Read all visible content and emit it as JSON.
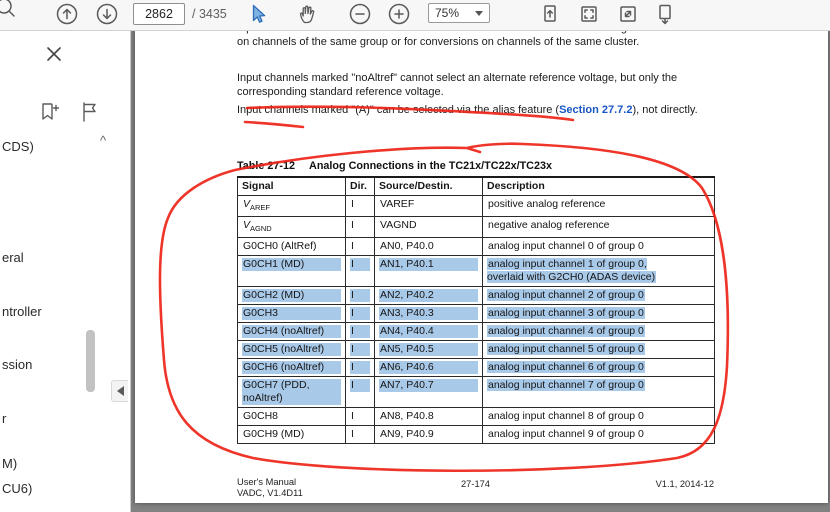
{
  "toolbar": {
    "page_current": "2862",
    "page_total": "/ 3435",
    "zoom_level": "75%",
    "icons": [
      "search",
      "page-up",
      "page-down",
      "select-tool",
      "hand-tool",
      "zoom-out",
      "zoom-in",
      "single-page-view",
      "fit-page",
      "fullscreen",
      "continuous-scroll"
    ]
  },
  "sidebar": {
    "items": [
      "CDS)",
      "eral",
      "ntroller",
      "ssion",
      "r",
      "M)",
      "CU6)"
    ]
  },
  "document": {
    "para1": "Input channels marked \"AltRef\" can be selected as an alternate reference voltage for conversions on channels of the same group or for conversions on channels of the same cluster.",
    "para2": "Input channels marked \"noAltref\" cannot select an alternate reference voltage, but only the corresponding standard reference voltage.",
    "para3_pre": "Input channels marked \"(A)\" can be selected via the alias feature (",
    "para3_link": "Section 27.7.2",
    "para3_post": "), not directly.",
    "table": {
      "title_label": "Table 27-12",
      "title_text": "Analog Connections in the TC21x/TC22x/TC23x",
      "headers": [
        "Signal",
        "Dir.",
        "Source/Destin.",
        "Description"
      ],
      "rows": [
        {
          "signal_main": "V",
          "signal_sub": "AREF",
          "dir": "I",
          "src": "VAREF",
          "desc": "positive analog reference",
          "hl": false
        },
        {
          "signal_main": "V",
          "signal_sub": "AGND",
          "dir": "I",
          "src": "VAGND",
          "desc": "negative analog reference",
          "hl": false
        },
        {
          "signal": "G0CH0 (AltRef)",
          "dir": "I",
          "src": "AN0, P40.0",
          "desc": "analog input channel 0 of group 0",
          "hl": false
        },
        {
          "signal": "G0CH1 (MD)",
          "dir": "I",
          "src": "AN1, P40.1",
          "desc": "analog input channel 1 of group 0,",
          "desc2": "overlaid with G2CH0 (ADAS device)",
          "hl": true
        },
        {
          "signal": "G0CH2 (MD)",
          "dir": "I",
          "src": "AN2, P40.2",
          "desc": "analog input channel 2 of group 0",
          "hl": true
        },
        {
          "signal": "G0CH3",
          "dir": "I",
          "src": "AN3, P40.3",
          "desc": "analog input channel 3 of group 0",
          "hl": true
        },
        {
          "signal": "G0CH4 (noAltref)",
          "dir": "I",
          "src": "AN4, P40.4",
          "desc": "analog input channel 4 of group 0",
          "hl": true
        },
        {
          "signal": "G0CH5 (noAltref)",
          "dir": "I",
          "src": "AN5, P40.5",
          "desc": "analog input channel 5 of group 0",
          "hl": true
        },
        {
          "signal": "G0CH6 (noAltref)",
          "dir": "I",
          "src": "AN6, P40.6",
          "desc": "analog input channel 6 of group 0",
          "hl": true
        },
        {
          "signal": "G0CH7 (PDD,",
          "signal2": "noAltref)",
          "dir": "I",
          "src": "AN7, P40.7",
          "desc": "analog input channel 7 of group 0",
          "hl": true
        },
        {
          "signal": "G0CH8",
          "dir": "I",
          "src": "AN8, P40.8",
          "desc": "analog input channel 8 of group 0",
          "hl": false
        },
        {
          "signal": "G0CH9 (MD)",
          "dir": "I",
          "src": "AN9, P40.9",
          "desc": "analog input channel 9 of group 0",
          "hl": false
        }
      ]
    },
    "footer": {
      "left_line1": "User's Manual",
      "left_line2": "VADC, V1.4D11",
      "page_label": "27-174",
      "version": "V1.1, 2014-12"
    }
  },
  "colors": {
    "selection_highlight": "#a9c9e9",
    "annotation_red": "#ee2418",
    "link_blue": "#1a56c4",
    "active_tool_blue": "#7eb3e3"
  }
}
